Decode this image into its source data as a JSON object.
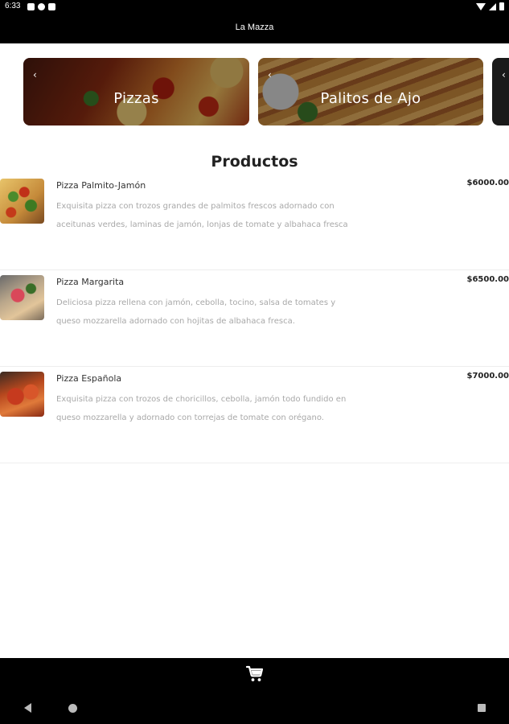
{
  "status_bar": {
    "time": "6:33"
  },
  "app_bar": {
    "title": "La Mazza"
  },
  "categories": [
    {
      "label": "Pizzas"
    },
    {
      "label": "Palitos de Ajo"
    }
  ],
  "section": {
    "title": "Productos"
  },
  "products": [
    {
      "name": "Pizza Palmito-Jamón",
      "description": "Exquisita pizza con trozos grandes de palmitos frescos adornado con aceitunas verdes, laminas de jamón, lonjas de tomate y albahaca fresca",
      "price": "$6000.00"
    },
    {
      "name": "Pizza Margarita",
      "description": "Deliciosa pizza rellena con jamón, cebolla, tocino, salsa de tomates y queso mozzarella adornado con hojitas de albahaca fresca.",
      "price": "$6500.00"
    },
    {
      "name": "Pizza Española",
      "description": "Exquisita pizza con trozos de choricillos, cebolla, jamón todo fundido en queso mozzarella y adornado con torrejas de tomate con orégano.",
      "price": "$7000.00"
    }
  ],
  "bottom_bar": {
    "icon": "shopping-cart-icon"
  },
  "nav_bar": {
    "icons": [
      "back-icon",
      "home-icon",
      "recents-icon"
    ]
  }
}
